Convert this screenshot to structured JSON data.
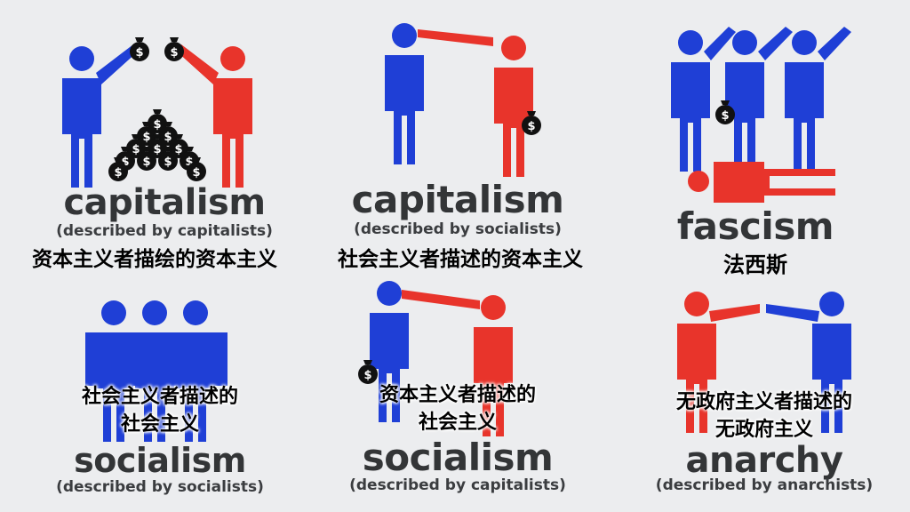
{
  "panels": [
    {
      "title": "capitalism",
      "subtitle": "(described by capitalists)",
      "caption": "资本主义者描绘的资本主义"
    },
    {
      "title": "capitalism",
      "subtitle": "(described by socialists)",
      "caption": "社会主义者描述的资本主义"
    },
    {
      "title": "fascism",
      "caption": "法西斯"
    },
    {
      "title": "socialism",
      "subtitle": "(described by socialists)",
      "caption_line1": "社会主义者描述的",
      "caption_line2": "社会主义"
    },
    {
      "title": "socialism",
      "subtitle": "(described by capitalists)",
      "caption_line1": "资本主义者描述的",
      "caption_line2": "社会主义"
    },
    {
      "title": "anarchy",
      "subtitle": "(described by anarchists)",
      "caption_line1": "无政府主义者描述的",
      "caption_line2": "无政府主义"
    }
  ],
  "colors": {
    "blue": "#1f3fd6",
    "red": "#e8342b",
    "text_dark": "#333537",
    "background": "#ecedef"
  },
  "icons": [
    "person-figure-icon",
    "money-bag-icon"
  ]
}
